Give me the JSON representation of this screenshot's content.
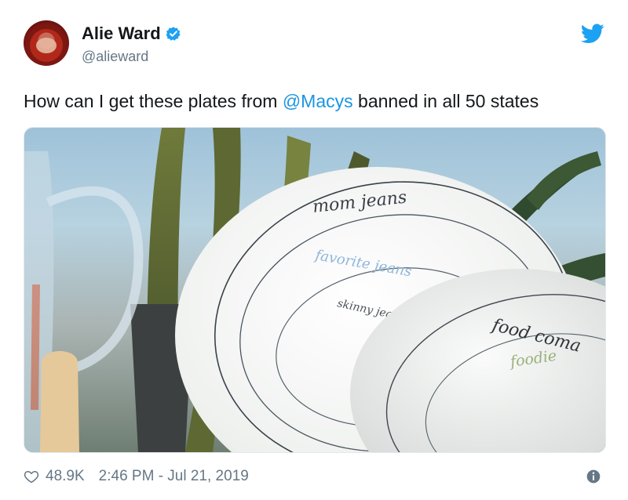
{
  "author": {
    "name": "Alie Ward",
    "handle": "@alieward"
  },
  "tweet": {
    "text_before": "How can I get these plates from ",
    "mention": "@Macys",
    "text_after": " banned in all 50 states"
  },
  "photo": {
    "plate_large_lines": [
      "mom jeans",
      "favorite jeans",
      "skinny jeans"
    ],
    "plate_small_lines": [
      "food coma",
      "foodie"
    ]
  },
  "footer": {
    "likes": "48.9K",
    "timestamp": "2:46 PM - Jul 21, 2019"
  },
  "icons": {
    "verified": "verified-badge-icon",
    "bird": "twitter-bird-icon",
    "heart": "heart-icon",
    "info": "info-icon"
  },
  "colors": {
    "accent": "#1b95e0",
    "muted": "#657786",
    "text": "#14171a"
  }
}
